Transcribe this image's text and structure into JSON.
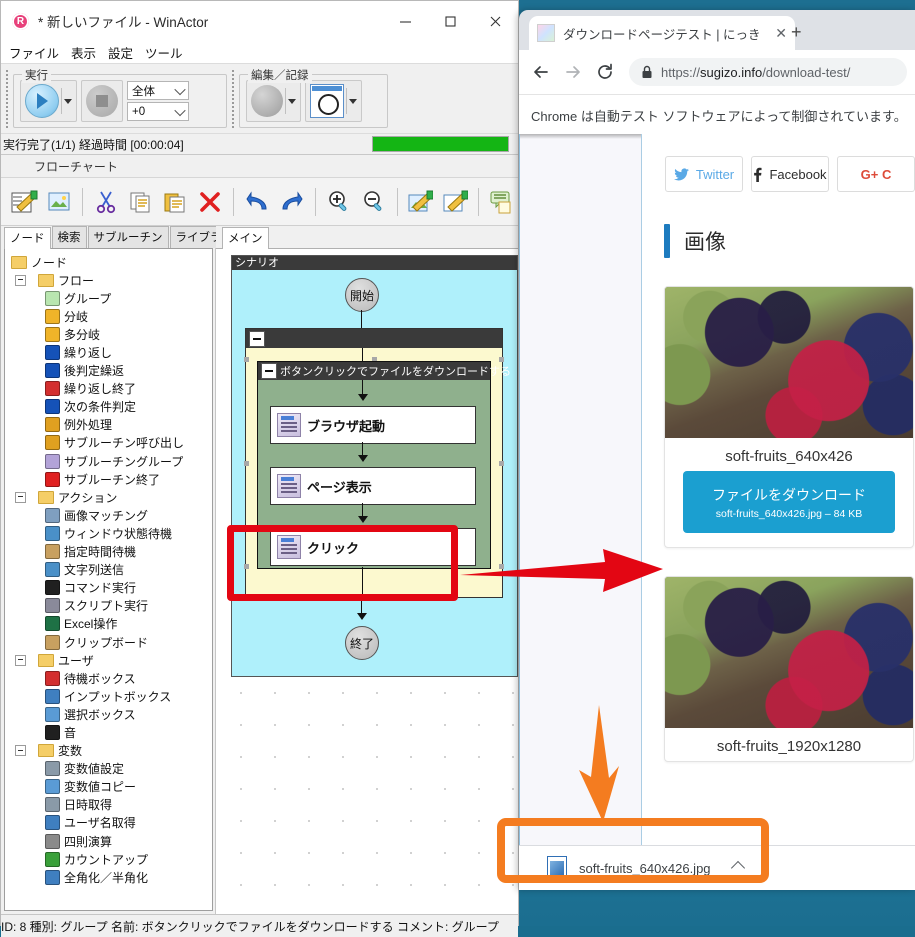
{
  "winactor": {
    "title": "* 新しいファイル - WinActor",
    "window_controls": {
      "minimize": "—",
      "maximize": "□",
      "close": "✕"
    },
    "menu": [
      "ファイル",
      "表示",
      "設定",
      "ツール"
    ],
    "ribbon": {
      "groups": [
        {
          "label": "実行",
          "combo_scope": "全体",
          "combo_offset": "+0"
        },
        {
          "label": "編集／記録"
        }
      ]
    },
    "status": {
      "text": "実行完了(1/1) 経過時間 [00:00:04]",
      "progress_percent": 100
    },
    "flow_label": "フローチャート",
    "toolbar_icons": [
      "edit-scenario-icon",
      "image-capture-icon",
      "cut-icon",
      "copy-icon",
      "paste-icon",
      "delete-icon",
      "undo-icon",
      "redo-icon",
      "zoom-in-icon",
      "zoom-out-icon",
      "image-edit-icon",
      "node-edit-icon",
      "comment-icon"
    ],
    "left_tabs": [
      "ノード",
      "検索",
      "サブルーチン",
      "ライブラリ"
    ],
    "active_left_tab": "ノード",
    "tree": [
      {
        "label": "ノード",
        "depth": 0,
        "type": "folder",
        "icon": "folder-icon"
      },
      {
        "label": "フロー",
        "depth": 1,
        "type": "folder",
        "icon": "folder-icon",
        "expander": true
      },
      {
        "label": "グループ",
        "depth": 2,
        "type": "item",
        "icon": "group-node-icon",
        "color": "#b9e6b0"
      },
      {
        "label": "分岐",
        "depth": 2,
        "type": "item",
        "icon": "branch-icon",
        "color": "#f0b429"
      },
      {
        "label": "多分岐",
        "depth": 2,
        "type": "item",
        "icon": "multi-branch-icon",
        "color": "#f0b429"
      },
      {
        "label": "繰り返し",
        "depth": 2,
        "type": "item",
        "icon": "loop-icon",
        "color": "#1552b8"
      },
      {
        "label": "後判定繰返",
        "depth": 2,
        "type": "item",
        "icon": "post-loop-icon",
        "color": "#1552b8"
      },
      {
        "label": "繰り返し終了",
        "depth": 2,
        "type": "item",
        "icon": "loop-end-icon",
        "color": "#d32f2f"
      },
      {
        "label": "次の条件判定",
        "depth": 2,
        "type": "item",
        "icon": "next-condition-icon",
        "color": "#1552b8"
      },
      {
        "label": "例外処理",
        "depth": 2,
        "type": "item",
        "icon": "exception-icon",
        "color": "#e0a020"
      },
      {
        "label": "サブルーチン呼び出し",
        "depth": 2,
        "type": "item",
        "icon": "subroutine-call-icon",
        "color": "#e0a020"
      },
      {
        "label": "サブルーチングループ",
        "depth": 2,
        "type": "item",
        "icon": "subroutine-group-icon",
        "color": "#b3a3d8"
      },
      {
        "label": "サブルーチン終了",
        "depth": 2,
        "type": "item",
        "icon": "subroutine-end-icon",
        "color": "#e02020"
      },
      {
        "label": "アクション",
        "depth": 1,
        "type": "folder",
        "icon": "folder-icon",
        "expander": true
      },
      {
        "label": "画像マッチング",
        "depth": 2,
        "type": "item",
        "icon": "image-matching-icon",
        "color": "#7f9fc0"
      },
      {
        "label": "ウィンドウ状態待機",
        "depth": 2,
        "type": "item",
        "icon": "window-wait-icon",
        "color": "#4a90c8"
      },
      {
        "label": "指定時間待機",
        "depth": 2,
        "type": "item",
        "icon": "timer-wait-icon",
        "color": "#c8a060"
      },
      {
        "label": "文字列送信",
        "depth": 2,
        "type": "item",
        "icon": "send-string-icon",
        "color": "#4a90c8"
      },
      {
        "label": "コマンド実行",
        "depth": 2,
        "type": "item",
        "icon": "command-exec-icon",
        "color": "#202020"
      },
      {
        "label": "スクリプト実行",
        "depth": 2,
        "type": "item",
        "icon": "script-exec-icon",
        "color": "#8a8a9a"
      },
      {
        "label": "Excel操作",
        "depth": 2,
        "type": "item",
        "icon": "excel-icon",
        "color": "#1e7145"
      },
      {
        "label": "クリップボード",
        "depth": 2,
        "type": "item",
        "icon": "clipboard-icon",
        "color": "#c8a060"
      },
      {
        "label": "ユーザ",
        "depth": 1,
        "type": "folder",
        "icon": "folder-icon",
        "expander": true
      },
      {
        "label": "待機ボックス",
        "depth": 2,
        "type": "item",
        "icon": "wait-box-icon",
        "color": "#d32f2f"
      },
      {
        "label": "インプットボックス",
        "depth": 2,
        "type": "item",
        "icon": "input-box-icon",
        "color": "#3f7fc0"
      },
      {
        "label": "選択ボックス",
        "depth": 2,
        "type": "item",
        "icon": "select-box-icon",
        "color": "#5a9bd5"
      },
      {
        "label": "音",
        "depth": 2,
        "type": "item",
        "icon": "sound-icon",
        "color": "#202020"
      },
      {
        "label": "変数",
        "depth": 1,
        "type": "folder",
        "icon": "folder-icon",
        "expander": true
      },
      {
        "label": "変数値設定",
        "depth": 2,
        "type": "item",
        "icon": "set-variable-icon",
        "color": "#8a9aa8"
      },
      {
        "label": "変数値コピー",
        "depth": 2,
        "type": "item",
        "icon": "copy-variable-icon",
        "color": "#5a9bd5"
      },
      {
        "label": "日時取得",
        "depth": 2,
        "type": "item",
        "icon": "get-datetime-icon",
        "color": "#8a9aa8"
      },
      {
        "label": "ユーザ名取得",
        "depth": 2,
        "type": "item",
        "icon": "get-username-icon",
        "color": "#3f7fc0"
      },
      {
        "label": "四則演算",
        "depth": 2,
        "type": "item",
        "icon": "arithmetic-icon",
        "color": "#8a8a8a"
      },
      {
        "label": "カウントアップ",
        "depth": 2,
        "type": "item",
        "icon": "count-up-icon",
        "color": "#3aa03a"
      },
      {
        "label": "全角化／半角化",
        "depth": 2,
        "type": "item",
        "icon": "zenkaku-hankaku-icon",
        "color": "#3f7fc0"
      }
    ],
    "main_tab": "メイン",
    "flowchart": {
      "scenario_label": "シナリオ",
      "start_node": "開始",
      "end_node": "終了",
      "group_title": "ボタンクリックでファイルをダウンロードする",
      "actions": [
        "ブラウザ起動",
        "ページ表示",
        "クリック"
      ],
      "highlighted_action": "クリック"
    },
    "status_bar": "ID: 8  種別: グループ   名前: ボタンクリックでファイルをダウンロードする  コメント: グループ"
  },
  "chrome": {
    "tab_title": "ダウンロードページテスト | にっき",
    "tab_close": "✕",
    "new_tab": "+",
    "url_secure_prefix": "https://",
    "url_domain": "sugizo.info",
    "url_path": "/download-test/",
    "url_full": "https://sugizo.info/download-test/",
    "infobar": "Chrome は自動テスト ソフトウェアによって制御されています。",
    "page": {
      "social_buttons": [
        {
          "label": "Twitter",
          "icon": "twitter-icon",
          "color": "#5aa9e6"
        },
        {
          "label": "Facebook",
          "icon": "facebook-icon",
          "color": "#2d2d2d"
        },
        {
          "label": "G+ C",
          "icon": "google-plus-icon",
          "color": "#dd4b39"
        }
      ],
      "section_title": "画像",
      "cards": [
        {
          "caption": "soft-fruits_640x426",
          "download_title": "ファイルをダウンロード",
          "download_sub": "soft-fruits_640x426.jpg – 84 KB"
        },
        {
          "caption": "soft-fruits_1920x1280"
        }
      ]
    },
    "download_shelf": {
      "file_name": "soft-fruits_640x426.jpg",
      "file_icon": "image-file-icon",
      "menu_caret": "caret-up-icon"
    }
  },
  "annotations": {
    "red_highlight_target": "クリック",
    "red_arrow": "points from flowchart click node to download button",
    "orange_arrow": "points from download button to download shelf item",
    "red_color": "#e30613",
    "orange_color": "#f47c20"
  }
}
